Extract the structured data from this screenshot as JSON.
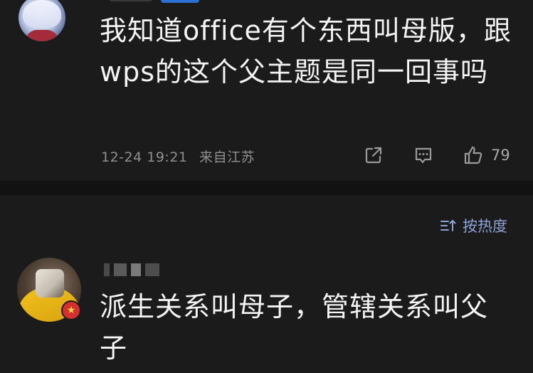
{
  "top_comment": {
    "text": "我知道office有个东西叫母版，跟wps的这个父主题是同一回事吗",
    "time": "12-24 19:21",
    "location": "来自江苏",
    "like_count": "79",
    "icons": {
      "share": "share-icon",
      "reply": "comment-icon",
      "like": "thumbs-up-icon"
    }
  },
  "sort": {
    "label": "按热度",
    "icon": "sort-icon"
  },
  "second_comment": {
    "text": "派生关系叫母子，管辖关系叫父子",
    "badge_icon": "star-badge-icon"
  },
  "colors": {
    "background": "#1b1b1b",
    "text": "#f4f4f4",
    "meta_text": "#8f8f8f",
    "accent": "#8ea3d6",
    "badge": "#d5302e"
  }
}
